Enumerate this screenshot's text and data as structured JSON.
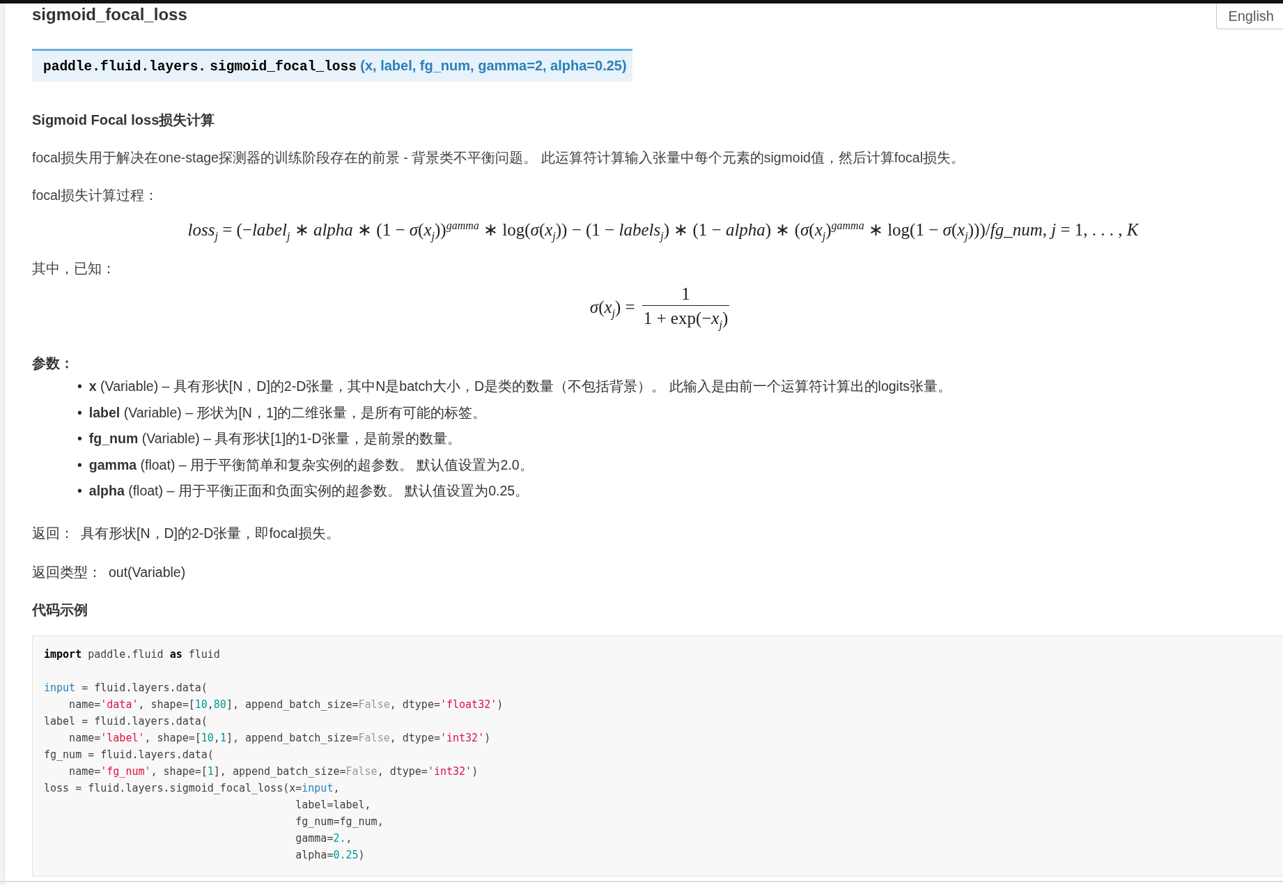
{
  "title": "sigmoid_focal_loss",
  "language_button": "English",
  "signature": {
    "prefix": "paddle.fluid.layers.",
    "name": "sigmoid_focal_loss",
    "params": "(x, label, fg_num, gamma=2, alpha=0.25)"
  },
  "heading": "Sigmoid Focal loss损失计算",
  "description": "focal损失用于解决在one-stage探测器的训练阶段存在的前景 - 背景类不平衡问题。 此运算符计算输入张量中每个元素的sigmoid值，然后计算focal损失。",
  "process_label": "focal损失计算过程：",
  "loss_formula": "*loss*$_{j}$ = (−*label*$_{j}$ ∗ *alpha* ∗ (1 − *σ*(*x*$_{j}$))$^{gamma}$ ∗ log(*σ*(*x*$_{j}$)) − (1 − *labels*$_{j}$) ∗ (1 − *alpha*) ∗ (*σ*(*x*$_{j}$)$^{gamma}$ ∗ log(1 − *σ*(*x*$_{j}$)))/*fg_num*, *j* = 1, . . . , *K*",
  "known_label": "其中，已知：",
  "sigmoid_formula": {
    "lhs": "*σ*(*x*$_{j}$) =",
    "numerator": "1",
    "denominator": "1 + exp(−*x*$_{j}$)"
  },
  "params_label": "参数：",
  "params": [
    {
      "bullet": "•",
      "text": "**x** (Variable) – 具有形状[N，D]的2-D张量，其中N是batch大小，D是类的数量（不包括背景）。 此输入是由前一个运算符计算出的logits张量。"
    },
    {
      "bullet": "•",
      "text": "**label** (Variable) – 形状为[N，1]的二维张量，是所有可能的标签。"
    },
    {
      "bullet": "•",
      "text": "**fg_num** (Variable) – 具有形状[1]的1-D张量，是前景的数量。"
    },
    {
      "bullet": "•",
      "text": "**gamma** (float) – 用于平衡简单和复杂实例的超参数。 默认值设置为2.0。"
    },
    {
      "bullet": "•",
      "text": "**alpha** (float) – 用于平衡正面和负面实例的超参数。 默认值设置为0.25。"
    }
  ],
  "returns": {
    "label": "返回：",
    "value": "具有形状[N，D]的2-D张量，即focal损失。"
  },
  "return_type": {
    "label": "返回类型：",
    "value": "out(Variable)"
  },
  "example_heading": "代码示例",
  "code": [
    {
      "tokens": [
        {
          "kind": "kw",
          "t": "import"
        },
        {
          "kind": "plain",
          "t": " paddle.fluid "
        },
        {
          "kind": "kw",
          "t": "as"
        },
        {
          "kind": "plain",
          "t": " fluid"
        }
      ]
    },
    {
      "blank_before": true,
      "tokens": [
        {
          "kind": "name",
          "t": "input"
        },
        {
          "kind": "plain",
          "t": " = fluid.layers.data("
        }
      ]
    },
    {
      "tokens": [
        {
          "kind": "plain",
          "t": "    name="
        },
        {
          "kind": "str",
          "t": "'data'"
        },
        {
          "kind": "plain",
          "t": ", shape=["
        },
        {
          "kind": "num",
          "t": "10"
        },
        {
          "kind": "plain",
          "t": ","
        },
        {
          "kind": "num",
          "t": "80"
        },
        {
          "kind": "plain",
          "t": "], append_batch_size="
        },
        {
          "kind": "const",
          "t": "False"
        },
        {
          "kind": "plain",
          "t": ", dtype="
        },
        {
          "kind": "str",
          "t": "'float32'"
        },
        {
          "kind": "plain",
          "t": ")"
        }
      ]
    },
    {
      "tokens": [
        {
          "kind": "plain",
          "t": "label = fluid.layers.data("
        }
      ]
    },
    {
      "tokens": [
        {
          "kind": "plain",
          "t": "    name="
        },
        {
          "kind": "str",
          "t": "'label'"
        },
        {
          "kind": "plain",
          "t": ", shape=["
        },
        {
          "kind": "num",
          "t": "10"
        },
        {
          "kind": "plain",
          "t": ","
        },
        {
          "kind": "num",
          "t": "1"
        },
        {
          "kind": "plain",
          "t": "], append_batch_size="
        },
        {
          "kind": "const",
          "t": "False"
        },
        {
          "kind": "plain",
          "t": ", dtype="
        },
        {
          "kind": "str",
          "t": "'int32'"
        },
        {
          "kind": "plain",
          "t": ")"
        }
      ]
    },
    {
      "tokens": [
        {
          "kind": "plain",
          "t": "fg_num = fluid.layers.data("
        }
      ]
    },
    {
      "tokens": [
        {
          "kind": "plain",
          "t": "    name="
        },
        {
          "kind": "str",
          "t": "'fg_num'"
        },
        {
          "kind": "plain",
          "t": ", shape=["
        },
        {
          "kind": "num",
          "t": "1"
        },
        {
          "kind": "plain",
          "t": "], append_batch_size="
        },
        {
          "kind": "const",
          "t": "False"
        },
        {
          "kind": "plain",
          "t": ", dtype="
        },
        {
          "kind": "str",
          "t": "'int32'"
        },
        {
          "kind": "plain",
          "t": ")"
        }
      ]
    },
    {
      "tokens": [
        {
          "kind": "plain",
          "t": "loss = fluid.layers.sigmoid_focal_loss(x="
        },
        {
          "kind": "name",
          "t": "input"
        },
        {
          "kind": "plain",
          "t": ","
        }
      ]
    },
    {
      "tokens": [
        {
          "kind": "plain",
          "t": "                                        label=label,"
        }
      ]
    },
    {
      "tokens": [
        {
          "kind": "plain",
          "t": "                                        fg_num=fg_num,"
        }
      ]
    },
    {
      "tokens": [
        {
          "kind": "plain",
          "t": "                                        gamma="
        },
        {
          "kind": "num",
          "t": "2."
        },
        {
          "kind": "plain",
          "t": ","
        }
      ]
    },
    {
      "tokens": [
        {
          "kind": "plain",
          "t": "                                        alpha="
        },
        {
          "kind": "num",
          "t": "0.25"
        },
        {
          "kind": "plain",
          "t": ")"
        }
      ]
    }
  ]
}
